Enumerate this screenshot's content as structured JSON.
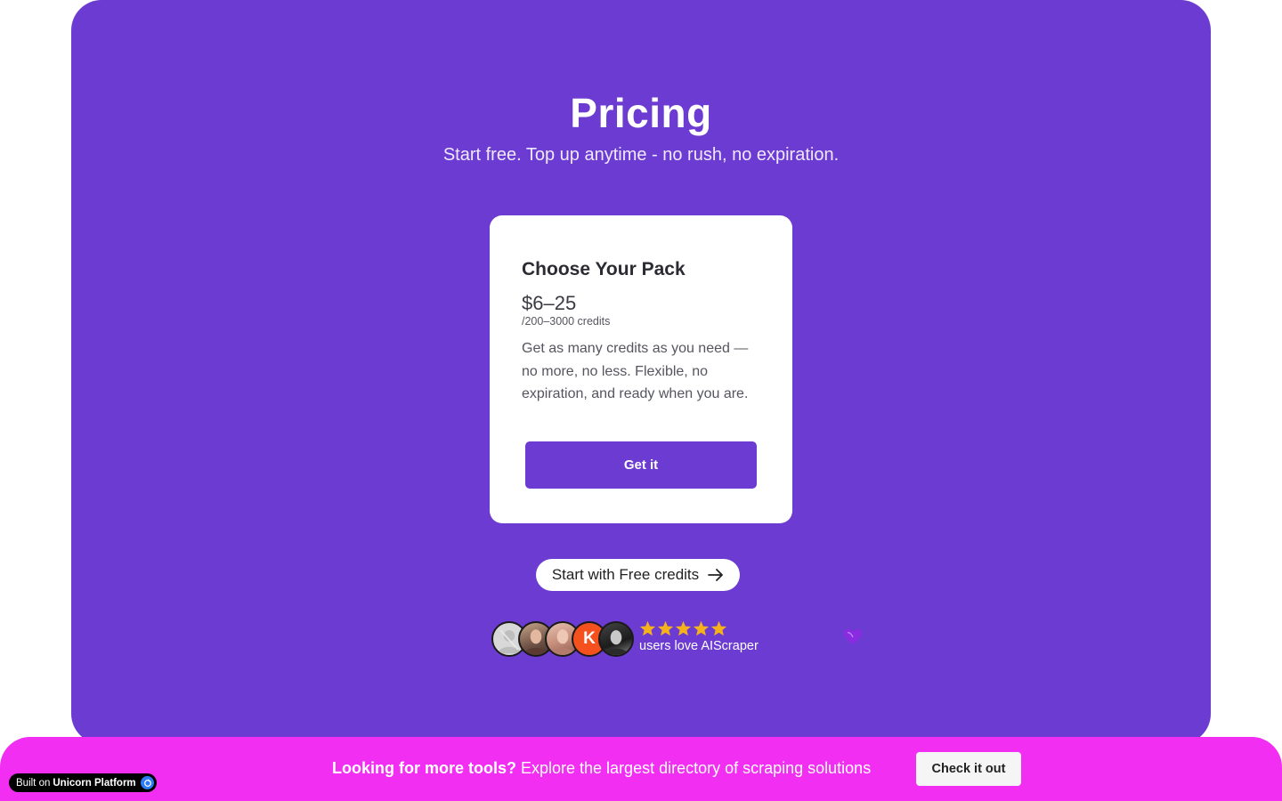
{
  "pricing": {
    "title": "Pricing",
    "subtitle": "Start free. Top up anytime - no rush, no expiration."
  },
  "card": {
    "title": "Choose Your Pack",
    "price": "$6–25",
    "period": "/200–3000 credits",
    "description": "Get as many credits as you need — no more, no less. Flexible, no expiration, and ready when you are.",
    "button_label": "Get it"
  },
  "free_cta": {
    "label": "Start with Free credits"
  },
  "social_proof": {
    "avatar_initial": "K",
    "rating_stars": 5,
    "text": "users love AIScraper"
  },
  "banner": {
    "strong": "Looking for more tools?",
    "text": "Explore the largest directory of scraping solutions",
    "button_label": "Check it out"
  },
  "badge": {
    "prefix": "Built on",
    "brand": "Unicorn Platform"
  },
  "colors": {
    "section_bg": "#6c3bd1",
    "banner_bg": "#f22ef2",
    "star": "#f6b21a",
    "heart": "#8a2be2"
  }
}
